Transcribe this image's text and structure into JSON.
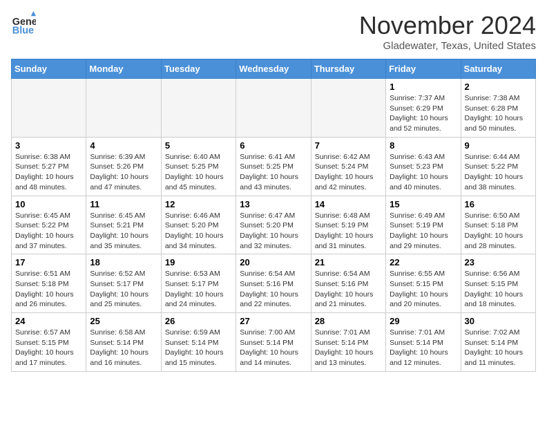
{
  "logo": {
    "line1": "General",
    "line2": "Blue"
  },
  "title": "November 2024",
  "location": "Gladewater, Texas, United States",
  "headers": [
    "Sunday",
    "Monday",
    "Tuesday",
    "Wednesday",
    "Thursday",
    "Friday",
    "Saturday"
  ],
  "weeks": [
    [
      {
        "day": "",
        "info": ""
      },
      {
        "day": "",
        "info": ""
      },
      {
        "day": "",
        "info": ""
      },
      {
        "day": "",
        "info": ""
      },
      {
        "day": "",
        "info": ""
      },
      {
        "day": "1",
        "info": "Sunrise: 7:37 AM\nSunset: 6:29 PM\nDaylight: 10 hours and 52 minutes."
      },
      {
        "day": "2",
        "info": "Sunrise: 7:38 AM\nSunset: 6:28 PM\nDaylight: 10 hours and 50 minutes."
      }
    ],
    [
      {
        "day": "3",
        "info": "Sunrise: 6:38 AM\nSunset: 5:27 PM\nDaylight: 10 hours and 48 minutes."
      },
      {
        "day": "4",
        "info": "Sunrise: 6:39 AM\nSunset: 5:26 PM\nDaylight: 10 hours and 47 minutes."
      },
      {
        "day": "5",
        "info": "Sunrise: 6:40 AM\nSunset: 5:25 PM\nDaylight: 10 hours and 45 minutes."
      },
      {
        "day": "6",
        "info": "Sunrise: 6:41 AM\nSunset: 5:25 PM\nDaylight: 10 hours and 43 minutes."
      },
      {
        "day": "7",
        "info": "Sunrise: 6:42 AM\nSunset: 5:24 PM\nDaylight: 10 hours and 42 minutes."
      },
      {
        "day": "8",
        "info": "Sunrise: 6:43 AM\nSunset: 5:23 PM\nDaylight: 10 hours and 40 minutes."
      },
      {
        "day": "9",
        "info": "Sunrise: 6:44 AM\nSunset: 5:22 PM\nDaylight: 10 hours and 38 minutes."
      }
    ],
    [
      {
        "day": "10",
        "info": "Sunrise: 6:45 AM\nSunset: 5:22 PM\nDaylight: 10 hours and 37 minutes."
      },
      {
        "day": "11",
        "info": "Sunrise: 6:45 AM\nSunset: 5:21 PM\nDaylight: 10 hours and 35 minutes."
      },
      {
        "day": "12",
        "info": "Sunrise: 6:46 AM\nSunset: 5:20 PM\nDaylight: 10 hours and 34 minutes."
      },
      {
        "day": "13",
        "info": "Sunrise: 6:47 AM\nSunset: 5:20 PM\nDaylight: 10 hours and 32 minutes."
      },
      {
        "day": "14",
        "info": "Sunrise: 6:48 AM\nSunset: 5:19 PM\nDaylight: 10 hours and 31 minutes."
      },
      {
        "day": "15",
        "info": "Sunrise: 6:49 AM\nSunset: 5:19 PM\nDaylight: 10 hours and 29 minutes."
      },
      {
        "day": "16",
        "info": "Sunrise: 6:50 AM\nSunset: 5:18 PM\nDaylight: 10 hours and 28 minutes."
      }
    ],
    [
      {
        "day": "17",
        "info": "Sunrise: 6:51 AM\nSunset: 5:18 PM\nDaylight: 10 hours and 26 minutes."
      },
      {
        "day": "18",
        "info": "Sunrise: 6:52 AM\nSunset: 5:17 PM\nDaylight: 10 hours and 25 minutes."
      },
      {
        "day": "19",
        "info": "Sunrise: 6:53 AM\nSunset: 5:17 PM\nDaylight: 10 hours and 24 minutes."
      },
      {
        "day": "20",
        "info": "Sunrise: 6:54 AM\nSunset: 5:16 PM\nDaylight: 10 hours and 22 minutes."
      },
      {
        "day": "21",
        "info": "Sunrise: 6:54 AM\nSunset: 5:16 PM\nDaylight: 10 hours and 21 minutes."
      },
      {
        "day": "22",
        "info": "Sunrise: 6:55 AM\nSunset: 5:15 PM\nDaylight: 10 hours and 20 minutes."
      },
      {
        "day": "23",
        "info": "Sunrise: 6:56 AM\nSunset: 5:15 PM\nDaylight: 10 hours and 18 minutes."
      }
    ],
    [
      {
        "day": "24",
        "info": "Sunrise: 6:57 AM\nSunset: 5:15 PM\nDaylight: 10 hours and 17 minutes."
      },
      {
        "day": "25",
        "info": "Sunrise: 6:58 AM\nSunset: 5:14 PM\nDaylight: 10 hours and 16 minutes."
      },
      {
        "day": "26",
        "info": "Sunrise: 6:59 AM\nSunset: 5:14 PM\nDaylight: 10 hours and 15 minutes."
      },
      {
        "day": "27",
        "info": "Sunrise: 7:00 AM\nSunset: 5:14 PM\nDaylight: 10 hours and 14 minutes."
      },
      {
        "day": "28",
        "info": "Sunrise: 7:01 AM\nSunset: 5:14 PM\nDaylight: 10 hours and 13 minutes."
      },
      {
        "day": "29",
        "info": "Sunrise: 7:01 AM\nSunset: 5:14 PM\nDaylight: 10 hours and 12 minutes."
      },
      {
        "day": "30",
        "info": "Sunrise: 7:02 AM\nSunset: 5:14 PM\nDaylight: 10 hours and 11 minutes."
      }
    ]
  ]
}
